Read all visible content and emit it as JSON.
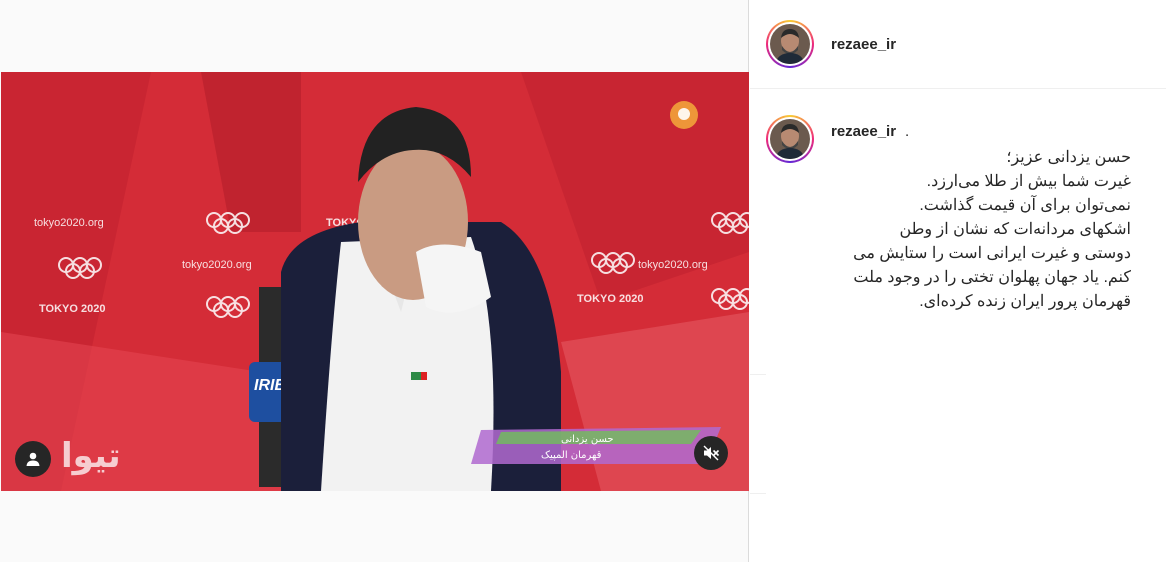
{
  "post": {
    "username": "rezaee_ir",
    "caption_author": "rezaee_ir",
    "caption_separator": ".",
    "caption_lines": [
      "حسن یزدانی عزیز؛",
      "غیرت شما بیش از طلا می‌ارزد.",
      "نمی‌توان برای آن قیمت گذاشت.",
      "اشکهای مردانه‌ات که نشان از وطن",
      "دوستی و غیرت ایرانی است را ستایش می",
      "کنم. یاد جهان پهلوان تختی را در وجود ملت",
      "قهرمان پرور ایران زنده کرده‌ای."
    ]
  },
  "video": {
    "backdrop_texts": {
      "tokyo_url": "tokyo2020.org",
      "tokyo_title": "TOKYO 2020",
      "tokyo_title_short": "TOKYO",
      "mic_brand": "IRIB",
      "channel_logo": "تیوا",
      "lower_third_name": "حسن یزدانی",
      "lower_third_title": "قهرمان المپیک"
    },
    "muted": true
  },
  "colors": {
    "backdrop_red": "#d42c37",
    "story_ring": [
      "#f9ce34",
      "#ee2a7b",
      "#6228d7"
    ],
    "text": "#262626"
  },
  "icons": {
    "user_tag": "user-icon",
    "mute": "speaker-muted-icon"
  }
}
